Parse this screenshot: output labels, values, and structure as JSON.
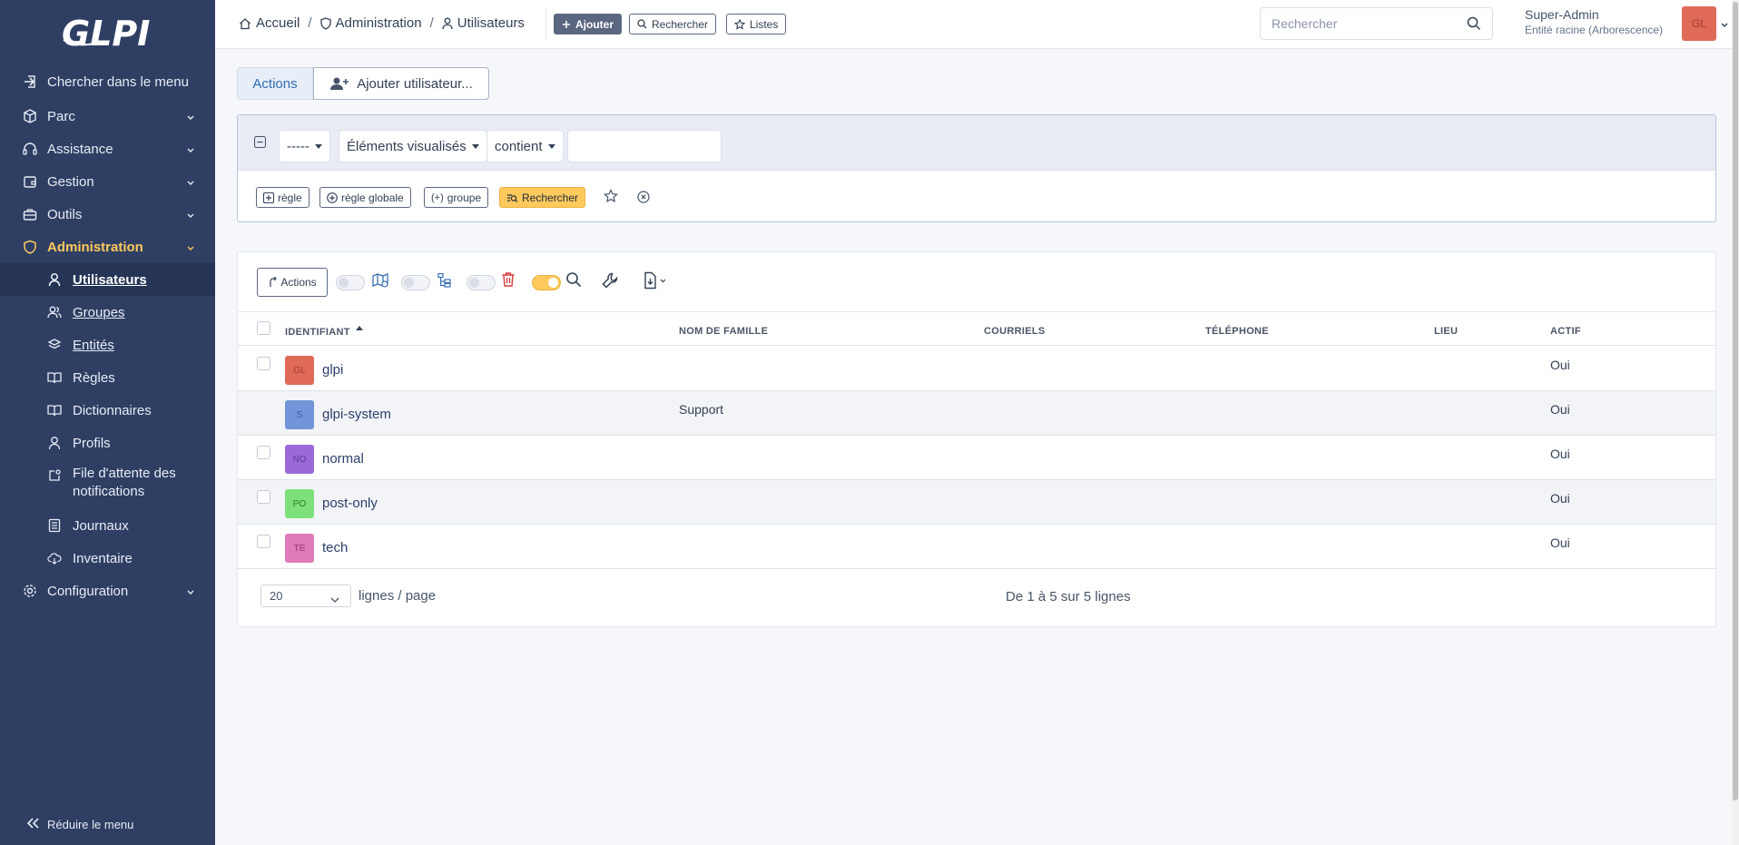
{
  "sidebar": {
    "logo": "GLPI",
    "items": [
      {
        "label": "Chercher dans le menu",
        "icon": "search-menu-icon"
      },
      {
        "label": "Parc",
        "icon": "box-icon"
      },
      {
        "label": "Assistance",
        "icon": "headset-icon"
      },
      {
        "label": "Gestion",
        "icon": "wallet-icon"
      },
      {
        "label": "Outils",
        "icon": "briefcase-icon"
      },
      {
        "label": "Administration",
        "icon": "shield-icon"
      },
      {
        "label": "Configuration",
        "icon": "gear-icon"
      }
    ],
    "subitems": [
      {
        "label": "Utilisateurs",
        "icon": "user-icon"
      },
      {
        "label": "Groupes",
        "icon": "users-icon"
      },
      {
        "label": "Entités",
        "icon": "layers-icon"
      },
      {
        "label": "Règles",
        "icon": "book-icon"
      },
      {
        "label": "Dictionnaires",
        "icon": "book-icon"
      },
      {
        "label": "Profils",
        "icon": "user-check-icon"
      },
      {
        "label": "File d'attente des notifications",
        "icon": "notification-icon"
      },
      {
        "label": "Journaux",
        "icon": "logs-icon"
      },
      {
        "label": "Inventaire",
        "icon": "cloud-download-icon"
      }
    ],
    "reduce_label": "Réduire le menu"
  },
  "header": {
    "breadcrumb": [
      "Accueil",
      "Administration",
      "Utilisateurs"
    ],
    "buttons": {
      "add": "Ajouter",
      "search": "Rechercher",
      "lists": "Listes"
    },
    "search_placeholder": "Rechercher",
    "user_name": "Super-Admin",
    "user_entity": "Entité racine (Arborescence)",
    "user_initials": "GL"
  },
  "tabs": {
    "actions": "Actions",
    "add_user": "Ajouter utilisateur..."
  },
  "criteria": {
    "field_select": "-----",
    "items_select": "Éléments visualisés",
    "operator_select": "contient",
    "value": "",
    "btn_rule": "règle",
    "btn_global_rule": "règle globale",
    "btn_group": "groupe",
    "btn_search": "Rechercher"
  },
  "results": {
    "actions_label": "Actions",
    "columns": [
      "IDENTIFIANT",
      "NOM DE FAMILLE",
      "COURRIELS",
      "TÉLÉPHONE",
      "LIEU",
      "ACTIF"
    ],
    "rows": [
      {
        "initials": "GL",
        "login": "glpi",
        "lastname": "",
        "active": "Oui",
        "color": "#e06a58",
        "text_color": "#a13a2c",
        "checkbox": true
      },
      {
        "initials": "S",
        "login": "glpi-system",
        "lastname": "Support",
        "active": "Oui",
        "color": "#7294d8",
        "text_color": "#3c5a99",
        "checkbox": false
      },
      {
        "initials": "NO",
        "login": "normal",
        "lastname": "",
        "active": "Oui",
        "color": "#9b6ad8",
        "text_color": "#5f3a94",
        "checkbox": true
      },
      {
        "initials": "PO",
        "login": "post-only",
        "lastname": "",
        "active": "Oui",
        "color": "#7ee07a",
        "text_color": "#2f7a2c",
        "checkbox": true
      },
      {
        "initials": "TE",
        "login": "tech",
        "lastname": "",
        "active": "Oui",
        "color": "#e07ab8",
        "text_color": "#8f3a6c",
        "checkbox": true
      }
    ],
    "page_size": "20",
    "page_size_label": "lignes / page",
    "pager_info": "De 1 à 5 sur 5 lignes"
  },
  "colors": {
    "sidebar_bg": "#2f3f64",
    "accent": "#fec95c",
    "primary_button": "#5b6780"
  }
}
